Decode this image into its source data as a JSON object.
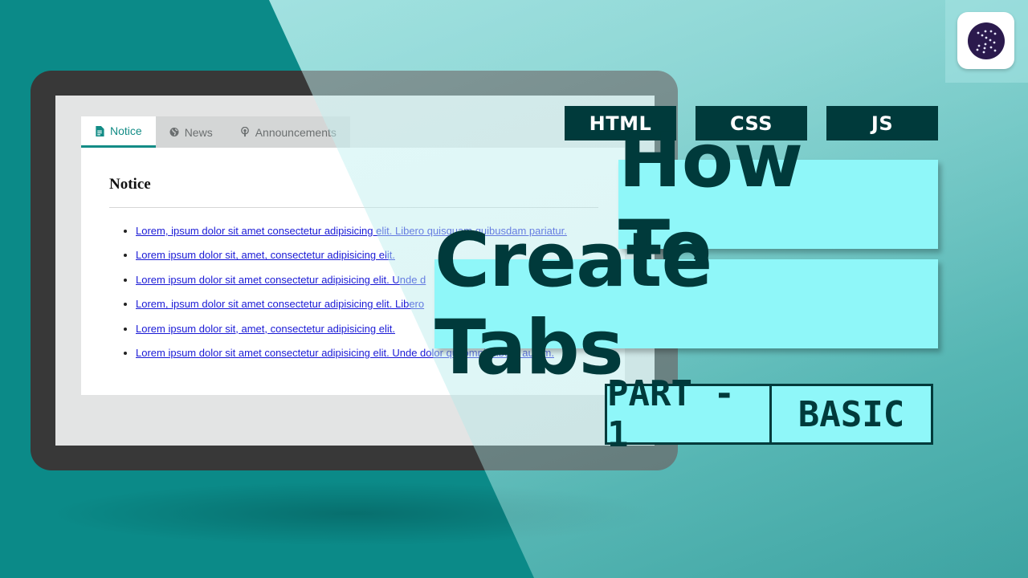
{
  "tabs": [
    {
      "label": "Notice",
      "icon": "document-icon",
      "active": true
    },
    {
      "label": "News",
      "icon": "globe-icon",
      "active": false
    },
    {
      "label": "Announcements",
      "icon": "podcast-icon",
      "active": false
    }
  ],
  "panel": {
    "heading": "Notice",
    "links": [
      "Lorem, ipsum dolor sit amet consectetur adipisicing elit. Libero quisquam quibusdam pariatur.",
      "Lorem ipsum dolor sit, amet, consectetur adipisicing elit.",
      "Lorem ipsum dolor sit amet consectetur adipisicing elit. Unde d",
      "Lorem, ipsum dolor sit amet consectetur adipisicing elit. Libero",
      "Lorem ipsum dolor sit, amet, consectetur adipisicing elit.",
      "Lorem ipsum dolor sit amet consectetur adipisicing elit. Unde dolor qui omnis libero autem."
    ]
  },
  "tags": [
    "HTML",
    "CSS",
    "JS"
  ],
  "title": {
    "line1": "How To",
    "line2": "Create Tabs"
  },
  "part": {
    "left": "PART - 1",
    "right": "BASIC"
  },
  "colors": {
    "teal": "#0b8a88",
    "accent": "#138c86",
    "dark": "#003a3b",
    "cyan": "#8ff7f9",
    "link": "#1a1ad6"
  }
}
